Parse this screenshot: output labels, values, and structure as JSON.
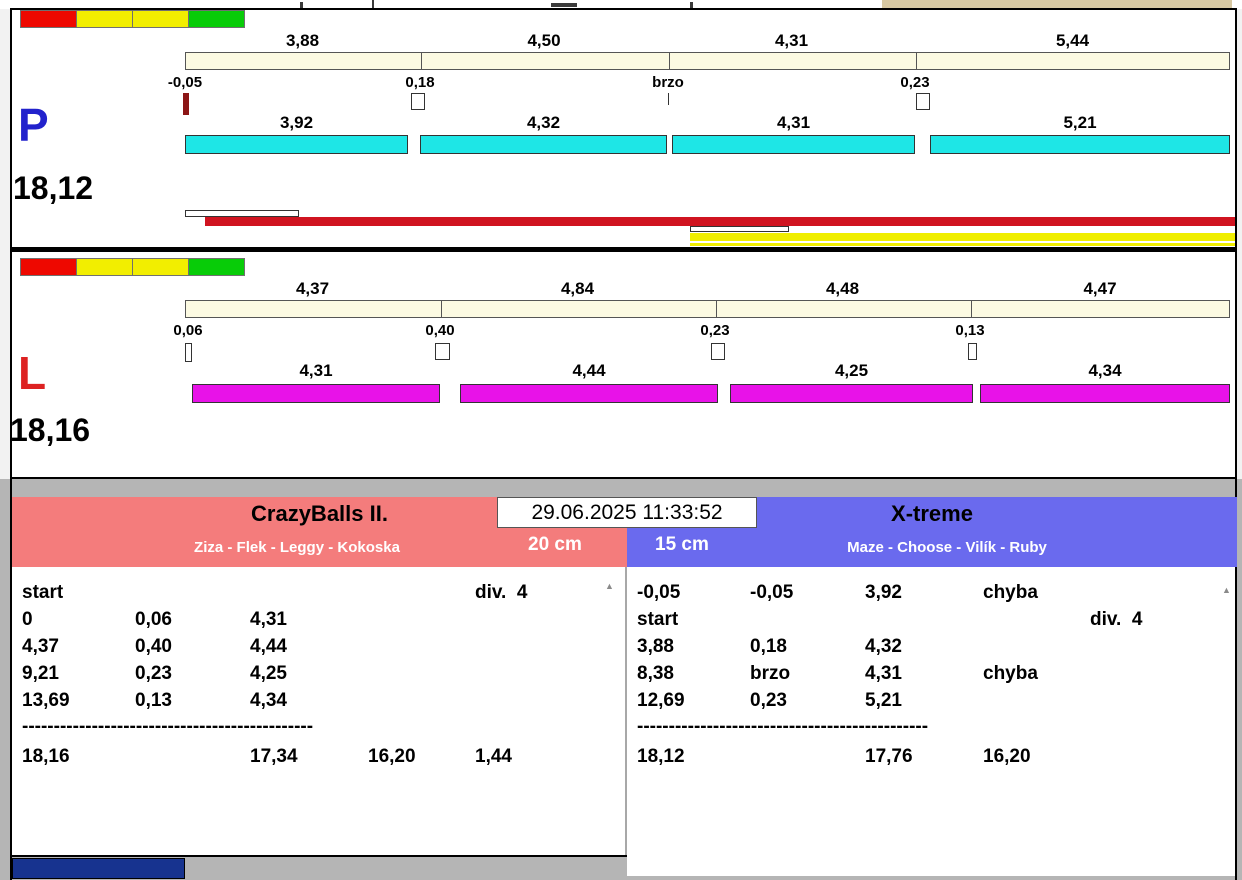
{
  "lanes": [
    {
      "letter": "P",
      "letter_color": "#2222cc",
      "total": "18,12",
      "bar_color": "#1ee6e6",
      "lights": [
        "#ee0800",
        "#f2ee00",
        "#f2ee00",
        "#08cc08"
      ],
      "run_bar_color": "#d01420",
      "next_bar_color": "#f0ee00",
      "start_marker_color": "#8c1616",
      "splits_top": [
        "3,88",
        "4,50",
        "4,31",
        "5,44"
      ],
      "ticks": [
        "-0,05",
        "0,18",
        "brzo",
        "0,23"
      ],
      "splits_bottom": [
        "3,92",
        "4,32",
        "4,31",
        "5,21"
      ]
    },
    {
      "letter": "L",
      "letter_color": "#dd2222",
      "total": "18,16",
      "bar_color": "#e812e8",
      "lights": [
        "#ee0800",
        "#f2ee00",
        "#f2ee00",
        "#08cc08"
      ],
      "splits_top": [
        "4,37",
        "4,84",
        "4,48",
        "4,47"
      ],
      "ticks": [
        "0,06",
        "0,40",
        "0,23",
        "0,13"
      ],
      "splits_bottom": [
        "4,31",
        "4,44",
        "4,25",
        "4,34"
      ]
    }
  ],
  "clock": {
    "datetime": "29.06.2025 11:33:52"
  },
  "icons": {
    "scroll_up": "▲"
  },
  "panels": {
    "left": {
      "team": "CrazyBalls II.",
      "dogs": "Ziza - Flek - Leggy - Kokoska",
      "height": "20 cm",
      "header_color": "#f47c7c",
      "divider": "----------------------------------------------",
      "rows": [
        [
          "start",
          "",
          "",
          "",
          "div.  4"
        ],
        [
          "0",
          "0,06",
          "4,31",
          "",
          ""
        ],
        [
          "4,37",
          "0,40",
          "4,44",
          "",
          ""
        ],
        [
          "9,21",
          "0,23",
          "4,25",
          "",
          ""
        ],
        [
          "13,69",
          "0,13",
          "4,34",
          "",
          ""
        ],
        [
          "18,16",
          "",
          "17,34",
          "16,20",
          "1,44"
        ]
      ]
    },
    "right": {
      "team": "X-treme",
      "dogs": "Maze - Choose - Vilík - Ruby",
      "height": "15 cm",
      "header_color": "#6a6aee",
      "divider": "----------------------------------------------",
      "rows": [
        [
          "-0,05",
          "-0,05",
          "3,92",
          "chyba",
          ""
        ],
        [
          "start",
          "",
          "",
          "",
          "div.  4"
        ],
        [
          "3,88",
          "0,18",
          "4,32",
          "",
          ""
        ],
        [
          "8,38",
          "brzo",
          "4,31",
          "chyba",
          ""
        ],
        [
          "12,69",
          "0,23",
          "5,21",
          "",
          ""
        ],
        [
          "18,12",
          "",
          "17,76",
          "16,20",
          ""
        ]
      ]
    }
  }
}
